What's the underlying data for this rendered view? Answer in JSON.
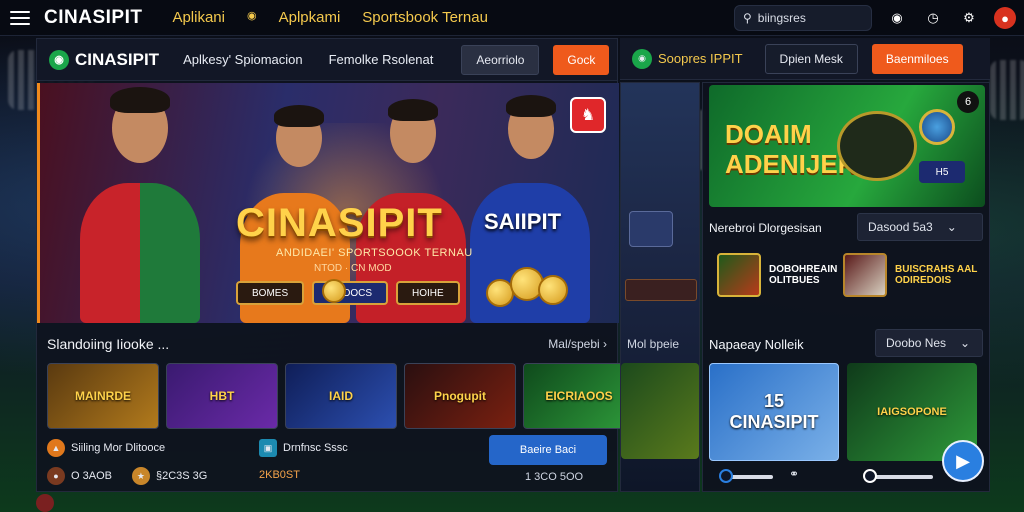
{
  "topbar": {
    "brand": "CINASIPIT",
    "nav": [
      "Aplikani",
      "Aplpkami",
      "Sportsbook Ternau"
    ],
    "search_value": "biingsres"
  },
  "panel": {
    "logo": "CINASIPIT",
    "nav": [
      "Aplkesy' Spiomacion",
      "Femolke Rsolenat"
    ],
    "ghost_btn": "Aeorriolo",
    "orange_btn": "Gock",
    "hero": {
      "title": "CINASIPIT",
      "subtitle": "ANDIDAEI' SPORTSOOOK TERNAU",
      "tag": "NTOD · CN MOD",
      "side_title": "SAIIPIT",
      "btn1": "BOMES",
      "btn2": "BOOOCS",
      "btn3": "HOIHE"
    },
    "section_title": "Slandoiing Iiooke ...",
    "section_more": "Mal/spebi",
    "thumbs": [
      "MAINRDE",
      "HBT",
      "IAID",
      "Pnogupit",
      "EICRIAOOS"
    ],
    "meta1": "Siiling Mor Dlitooce",
    "meta2_a": "O 3AOB",
    "meta2_b": "§2C3S 3G",
    "meta3": "Drnfnsc Sssc",
    "meta3_sub": "2KB0ST",
    "blue_btn": "Baeire Baci",
    "blue_btn_sub": "1 3CO 5OO"
  },
  "right": {
    "header_label": "Soopres IPPIT",
    "header_btn": "Dpien Mesk",
    "header_orange": "Baenmiloes",
    "promo_title_1": "DOAIM",
    "promo_title_2": "ADENIJER",
    "promo_badge": "6",
    "promo_chip": "H5",
    "filter1_title": "Nerebroi Dlorgesisan",
    "filter1_value": "Dasood 5a3",
    "mini1": "DOBOHREAIN\nOLITBUES",
    "mini2": "BUISCRAHS AAL\nODIREDOIS",
    "filter2_title": "Napaeay Nolleik",
    "filter2_value": "Doobo Nes",
    "thumb1": "15\nCINASIPIT",
    "thumb2": "IAIGSOPONE",
    "sliver_label": "Mol bpeie"
  },
  "colors": {
    "accent_orange": "#ef5a1c",
    "accent_blue": "#2566c9",
    "brand_gold": "#ffd24a"
  }
}
